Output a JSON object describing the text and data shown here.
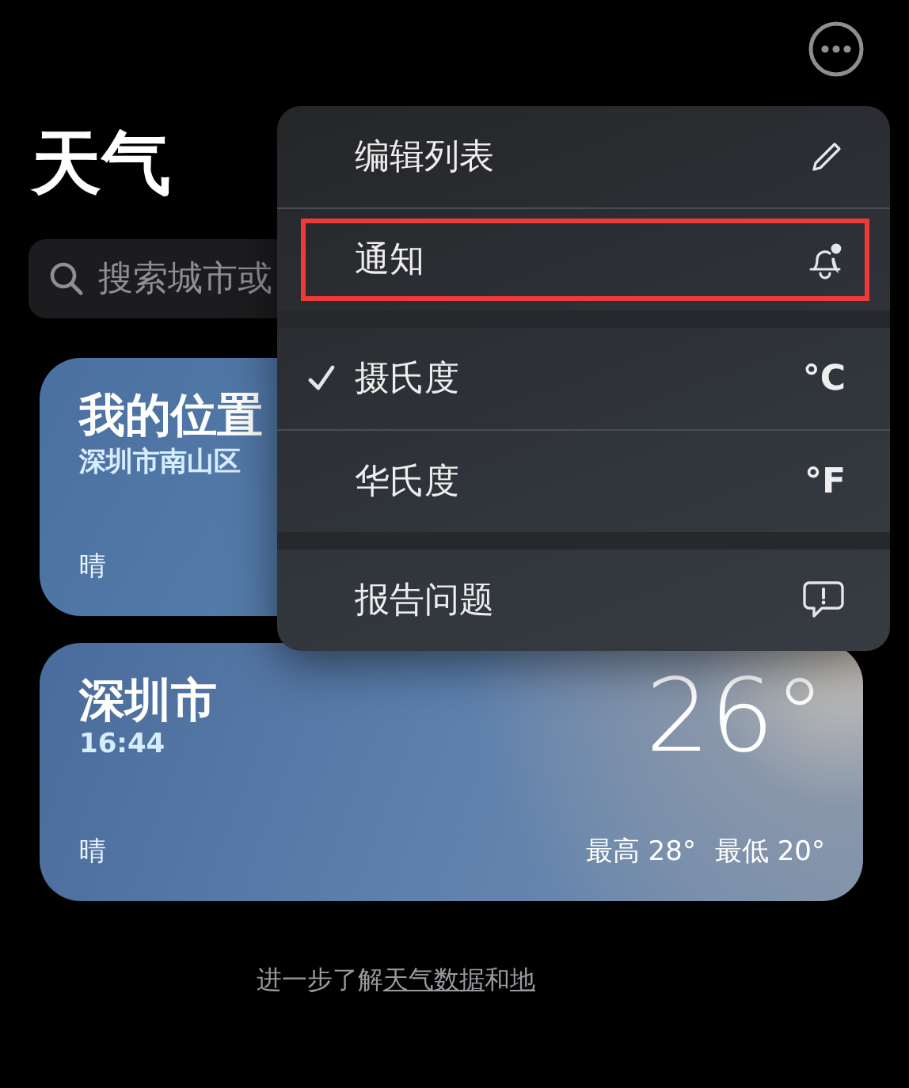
{
  "header": {
    "title": "天气"
  },
  "search": {
    "placeholder": "搜索城市或"
  },
  "cards": [
    {
      "name": "我的位置",
      "subtitle": "深圳市南山区",
      "condition": "晴"
    },
    {
      "name": "深圳市",
      "subtitle": "16:44",
      "condition": "晴",
      "temperature": "26°",
      "high": "最高 28°",
      "low": "最低 20°"
    }
  ],
  "footer": {
    "text": "进一步了解",
    "link_1": "天气数据",
    "joiner": "和",
    "link_2": "地"
  },
  "menu": {
    "sections": [
      [
        {
          "kind": "edit",
          "label": "编辑列表",
          "highlighted": false
        },
        {
          "kind": "notifications",
          "label": "通知",
          "highlighted": true
        }
      ],
      [
        {
          "kind": "unit",
          "label": "摄氏度",
          "symbol": "°C",
          "selected": true
        },
        {
          "kind": "unit",
          "label": "华氏度",
          "symbol": "°F",
          "selected": false
        }
      ],
      [
        {
          "kind": "report",
          "label": "报告问题",
          "highlighted": false
        }
      ]
    ]
  }
}
